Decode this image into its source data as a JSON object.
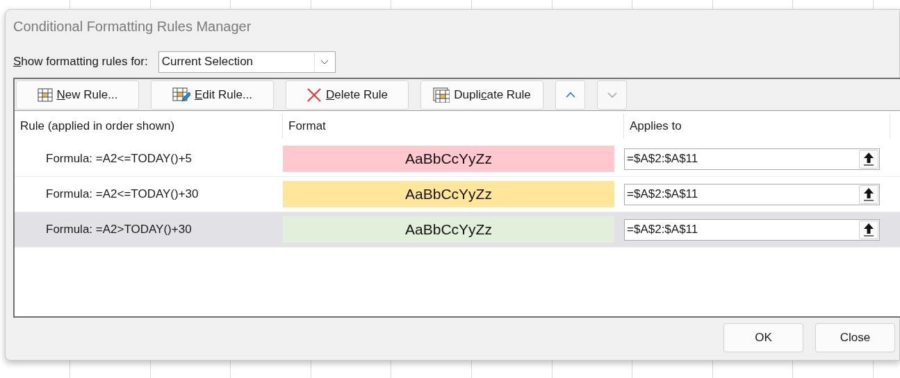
{
  "dialog": {
    "title": "Conditional Formatting Rules Manager",
    "show_rules_for": {
      "access_key": "S",
      "label_post": "how formatting rules for:",
      "value": "Current Selection"
    },
    "toolbar": [
      {
        "kind": "new",
        "access_key": "N",
        "label_post": "ew Rule...",
        "disabled": false
      },
      {
        "kind": "edit",
        "access_key": "E",
        "label_post": "dit Rule...",
        "disabled": false
      },
      {
        "kind": "delete",
        "access_key": "D",
        "label_post": "elete Rule",
        "disabled": false
      },
      {
        "kind": "duplicate",
        "label_pre": "Dupli",
        "access_key": "c",
        "label_post": "ate Rule",
        "disabled": false
      },
      {
        "kind": "move_up",
        "disabled": false
      },
      {
        "kind": "move_down",
        "disabled": true
      }
    ],
    "columns": [
      "Rule (applied in order shown)",
      "Format",
      "Applies to"
    ],
    "rules": [
      {
        "rule": "Formula: =A2<=TODAY()+5",
        "preview": "AaBbCcYyZz",
        "color": "#ffc7ce",
        "applies_to": "=$A$2:$A$11",
        "selected": false
      },
      {
        "rule": "Formula: =A2<=TODAY()+30",
        "preview": "AaBbCcYyZz",
        "color": "#ffe699",
        "applies_to": "=$A$2:$A$11",
        "selected": false
      },
      {
        "rule": "Formula: =A2>TODAY()+30",
        "preview": "AaBbCcYyZz",
        "color": "#e2efda",
        "applies_to": "=$A$2:$A$11",
        "selected": true
      }
    ],
    "buttons": [
      "OK",
      "Close"
    ]
  }
}
